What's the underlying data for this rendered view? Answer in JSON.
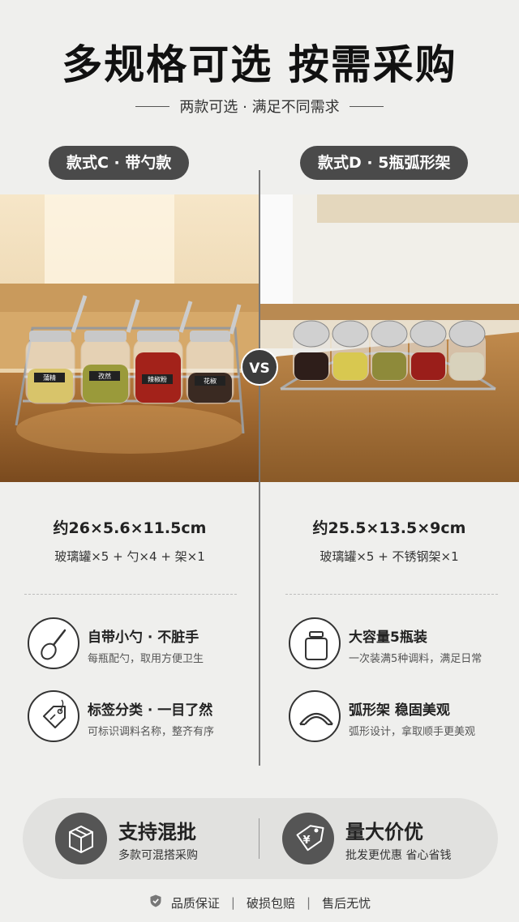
{
  "header": {
    "title": "多规格可选 按需采购",
    "subtitle": "两款可选 · 满足不同需求"
  },
  "left": {
    "pill": "款式C · 带勺款",
    "dimension": "约26×5.6×11.5cm",
    "contents": "玻璃罐×5 + 勺×4 + 架×1",
    "jar_labels": [
      "蒲精",
      "孜然",
      "辣椒粉",
      "花椒"
    ],
    "features": [
      {
        "title": "自带小勺 · 不脏手",
        "desc": "每瓶配勺，取用方便卫生",
        "icon": "spoon-icon"
      },
      {
        "title": "标签分类 · 一目了然",
        "desc": "可标识调料名称，整齐有序",
        "icon": "tag-icon"
      }
    ]
  },
  "right": {
    "pill": "款式D · 5瓶弧形架",
    "dimension": "约25.5×13.5×9cm",
    "contents": "玻璃罐×5 + 不锈钢架×1",
    "features": [
      {
        "title": "大容量5瓶装",
        "desc": "一次装满5种调料，满足日常",
        "icon": "jar-icon"
      },
      {
        "title": "弧形架 稳固美观",
        "desc": "弧形设计，拿取顺手更美观",
        "icon": "arc-rack-icon"
      }
    ]
  },
  "vs_label": "VS",
  "bottom": {
    "left": {
      "title": "支持混批",
      "desc": "多款可混搭采购",
      "icon": "box-icon"
    },
    "right": {
      "title": "量大价优",
      "desc": "批发更优惠 省心省钱",
      "icon": "price-tag-icon",
      "tag_text": "¥"
    }
  },
  "footer": {
    "items": [
      "品质保证",
      "破损包赔",
      "售后无忧"
    ],
    "separator": "|",
    "icon": "shield-icon"
  }
}
